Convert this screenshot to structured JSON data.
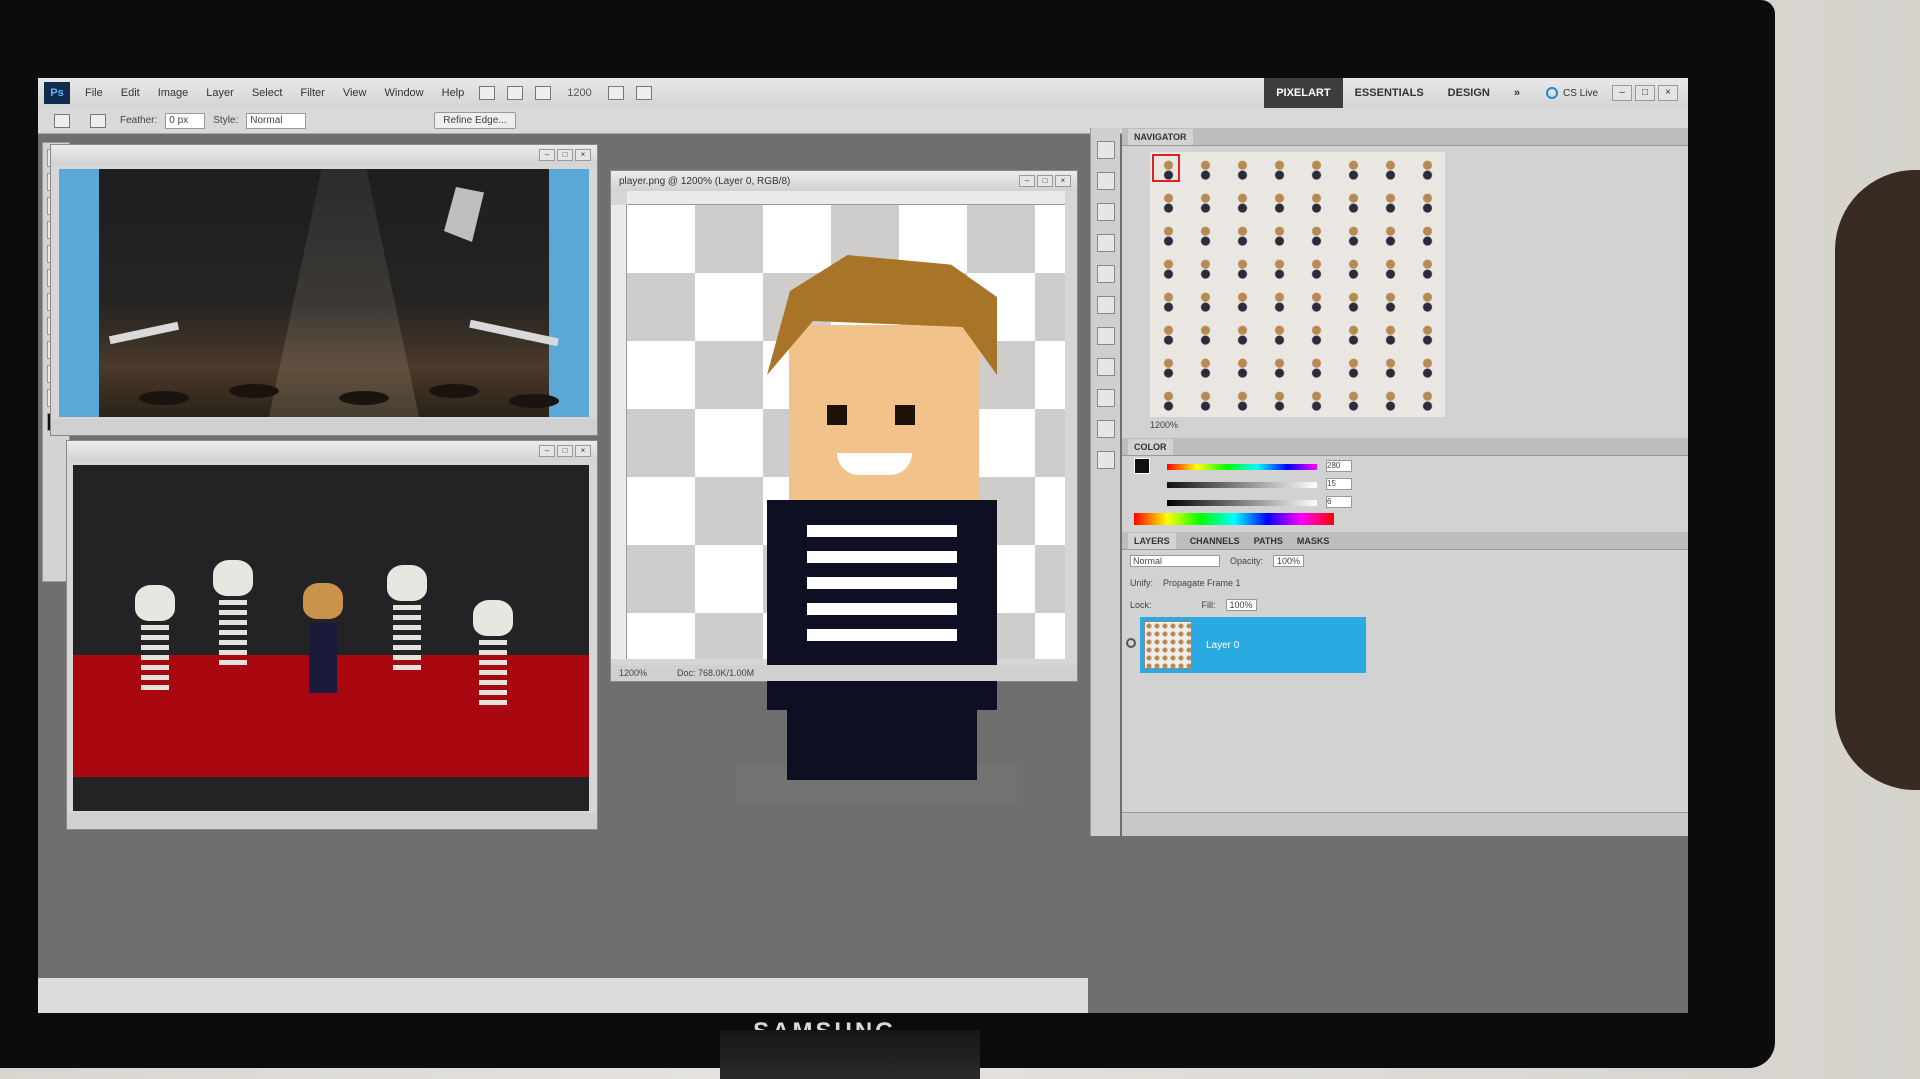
{
  "monitor": {
    "brand": "SAMSUNG"
  },
  "menubar": {
    "logo": "Ps",
    "items": [
      "File",
      "Edit",
      "Image",
      "Layer",
      "Select",
      "Filter",
      "View",
      "Window",
      "Help"
    ],
    "zoom": "1200",
    "workspaces": [
      "PIXELART",
      "ESSENTIALS",
      "DESIGN"
    ],
    "more": "»",
    "cs_live": "CS Live"
  },
  "optbar": {
    "feather_label": "Feather:",
    "feather_value": "0 px",
    "style_label": "Style:",
    "style_value": "Normal",
    "refine_edge": "Refine Edge..."
  },
  "docs": {
    "player": {
      "title": "player.png @ 1200% (Layer 0, RGB/8)",
      "zoom": "1200%",
      "doc_size": "Doc: 768.0K/1.00M"
    }
  },
  "navigator": {
    "title": "NAVIGATOR",
    "zoom": "1200%"
  },
  "color": {
    "title": "COLOR",
    "h": "280",
    "s": "15",
    "b": "6",
    "pct": "%"
  },
  "layers": {
    "tabs": [
      "LAYERS",
      "CHANNELS",
      "PATHS",
      "MASKS"
    ],
    "blend_mode": "Normal",
    "opacity_label": "Opacity:",
    "opacity_value": "100%",
    "unify_label": "Unify:",
    "propagate": "Propagate Frame 1",
    "lock_label": "Lock:",
    "fill_label": "Fill:",
    "fill_value": "100%",
    "layer_name": "Layer 0"
  },
  "colors": {
    "accent": "#2aaae0",
    "carpet": "#a8070f",
    "hair": "#a77428"
  }
}
